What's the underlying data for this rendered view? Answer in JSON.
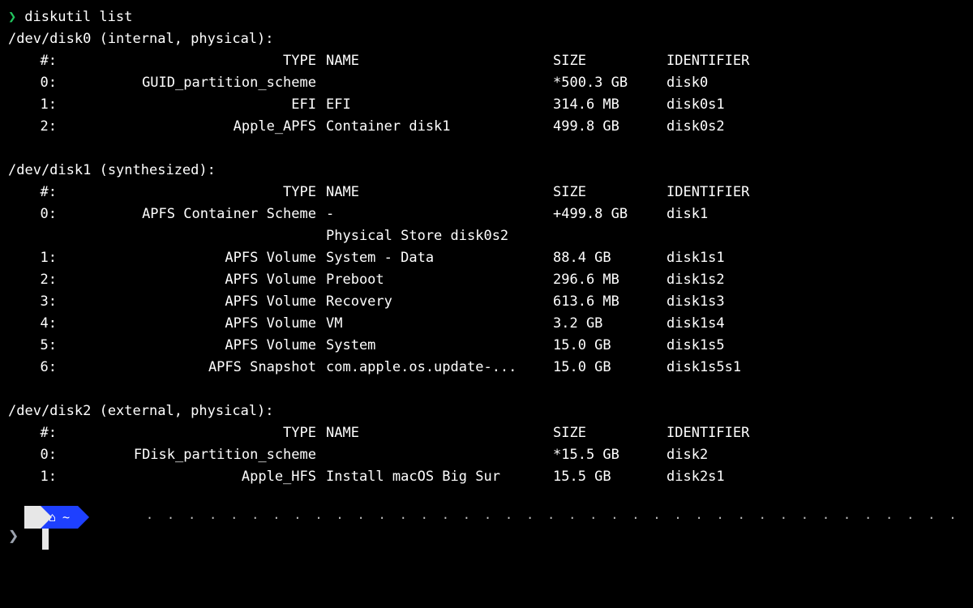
{
  "prompt": "❯",
  "command": "diskutil list",
  "columns": {
    "idx": "#:",
    "type": "TYPE",
    "name": "NAME",
    "size": "SIZE",
    "ident": "IDENTIFIER"
  },
  "disks": [
    {
      "header": "/dev/disk0 (internal, physical):",
      "rows": [
        {
          "idx": "0:",
          "type": "GUID_partition_scheme",
          "name": "",
          "size": "*500.3 GB",
          "ident": "disk0"
        },
        {
          "idx": "1:",
          "type": "EFI",
          "name": "EFI",
          "size": "314.6 MB",
          "ident": "disk0s1"
        },
        {
          "idx": "2:",
          "type": "Apple_APFS",
          "name": "Container disk1",
          "size": "499.8 GB",
          "ident": "disk0s2"
        }
      ]
    },
    {
      "header": "/dev/disk1 (synthesized):",
      "rows": [
        {
          "idx": "0:",
          "type": "APFS Container Scheme",
          "name": "-",
          "size": "+499.8 GB",
          "ident": "disk1"
        },
        {
          "idx": "",
          "type": "",
          "name": "Physical Store disk0s2",
          "size": "",
          "ident": ""
        },
        {
          "idx": "1:",
          "type": "APFS Volume",
          "name": "System - Data",
          "size": "88.4 GB",
          "ident": "disk1s1"
        },
        {
          "idx": "2:",
          "type": "APFS Volume",
          "name": "Preboot",
          "size": "296.6 MB",
          "ident": "disk1s2"
        },
        {
          "idx": "3:",
          "type": "APFS Volume",
          "name": "Recovery",
          "size": "613.6 MB",
          "ident": "disk1s3"
        },
        {
          "idx": "4:",
          "type": "APFS Volume",
          "name": "VM",
          "size": "3.2 GB",
          "ident": "disk1s4"
        },
        {
          "idx": "5:",
          "type": "APFS Volume",
          "name": "System",
          "size": "15.0 GB",
          "ident": "disk1s5"
        },
        {
          "idx": "6:",
          "type": "APFS Snapshot",
          "name": "com.apple.os.update-...",
          "size": "15.0 GB",
          "ident": "disk1s5s1"
        }
      ]
    },
    {
      "header": "/dev/disk2 (external, physical):",
      "rows": [
        {
          "idx": "0:",
          "type": "FDisk_partition_scheme",
          "name": "",
          "size": "*15.5 GB",
          "ident": "disk2"
        },
        {
          "idx": "1:",
          "type": "Apple_HFS",
          "name": "Install macOS Big Sur",
          "size": "15.5 GB",
          "ident": "disk2s1"
        }
      ]
    }
  ],
  "powerline": {
    "apple": "",
    "home_icon": "⌂",
    "tilde": "~",
    "cursor": "❯"
  }
}
